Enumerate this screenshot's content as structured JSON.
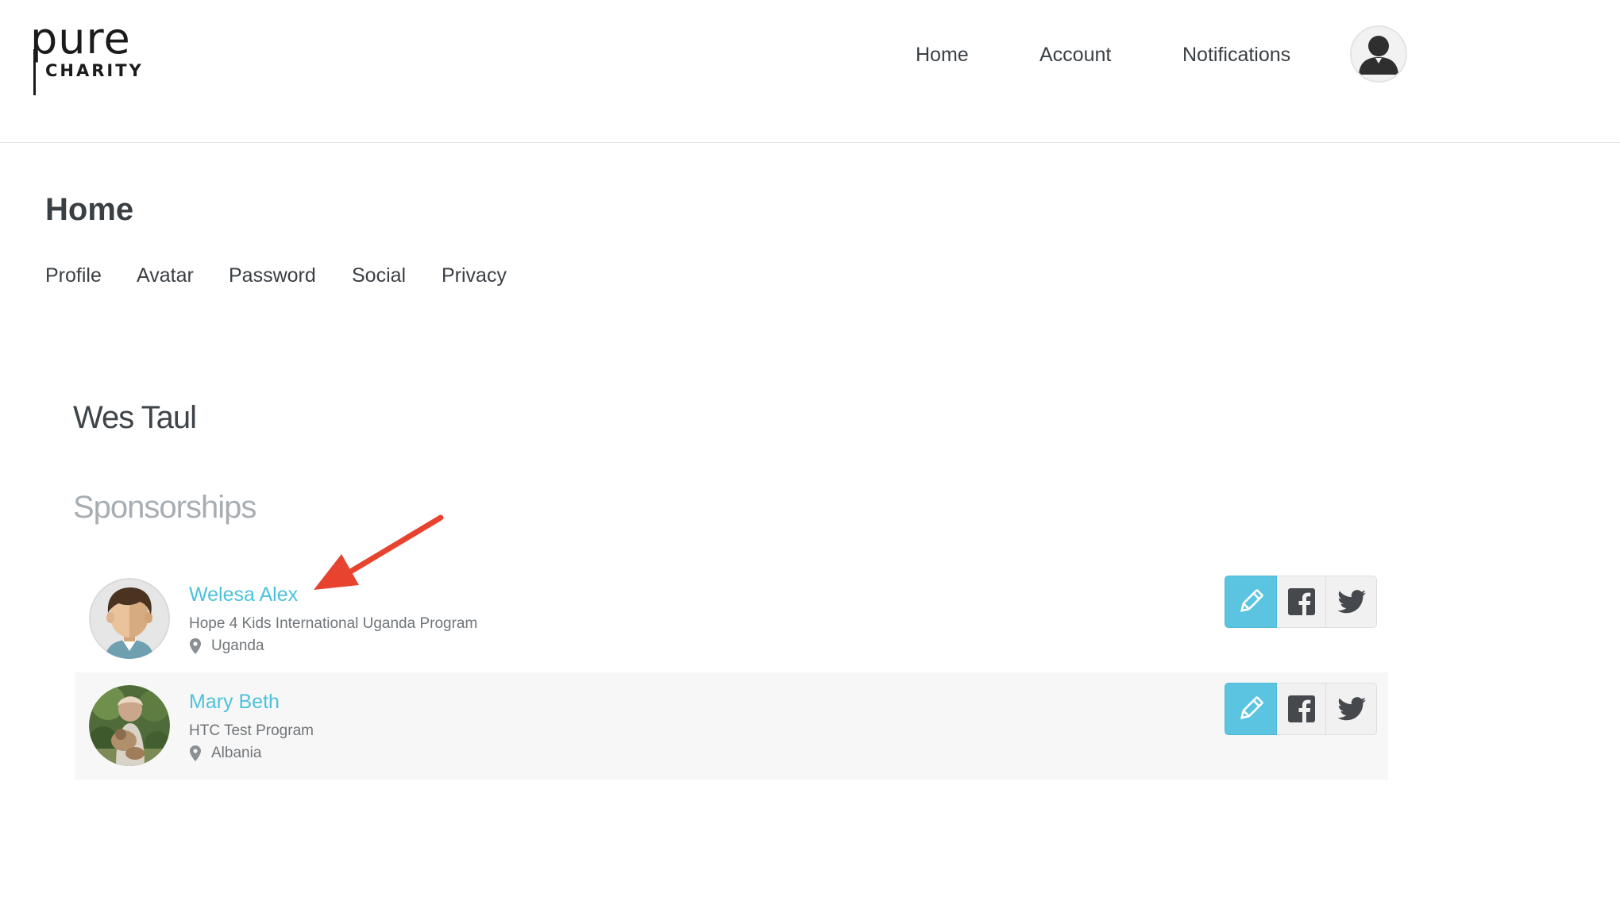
{
  "logo": {
    "word_top": "pure",
    "word_bottom": "CHARITY"
  },
  "topnav": {
    "home": "Home",
    "account": "Account",
    "notifications": "Notifications"
  },
  "page": {
    "title": "Home"
  },
  "subnav": {
    "items": [
      "Profile",
      "Avatar",
      "Password",
      "Social",
      "Privacy"
    ]
  },
  "user": {
    "name": "Wes Taul"
  },
  "sponsorships": {
    "title": "Sponsorships",
    "items": [
      {
        "name": "Welesa Alex",
        "program": "Hope 4 Kids International Uganda Program",
        "country": "Uganda"
      },
      {
        "name": "Mary Beth",
        "program": "HTC Test Program",
        "country": "Albania"
      }
    ]
  },
  "colors": {
    "accent": "#4cc2dd",
    "edit_button": "#5bc4e0",
    "annotation": "#e8432e"
  },
  "icons": {
    "edit": "pencil-icon",
    "facebook": "facebook-icon",
    "twitter": "twitter-icon",
    "location": "map-pin-icon"
  }
}
